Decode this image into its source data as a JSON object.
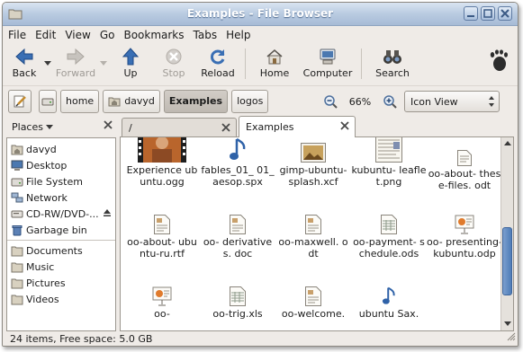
{
  "window": {
    "title": "Examples - File Browser"
  },
  "menubar": {
    "items": [
      "File",
      "Edit",
      "View",
      "Go",
      "Bookmarks",
      "Tabs",
      "Help"
    ]
  },
  "toolbar": {
    "back": "Back",
    "forward": "Forward",
    "up": "Up",
    "stop": "Stop",
    "reload": "Reload",
    "home": "Home",
    "computer": "Computer",
    "search": "Search"
  },
  "location": {
    "crumbs": [
      "home",
      "davyd",
      "Examples",
      "logos"
    ],
    "zoom_level": "66%",
    "view_mode": "Icon View"
  },
  "sidebar": {
    "header": "Places",
    "items": [
      {
        "label": "davyd",
        "icon": "home-folder-icon"
      },
      {
        "label": "Desktop",
        "icon": "desktop-icon"
      },
      {
        "label": "File System",
        "icon": "harddisk-icon"
      },
      {
        "label": "Network",
        "icon": "network-icon"
      },
      {
        "label": "CD-RW/DVD-...",
        "icon": "optical-drive-icon"
      },
      {
        "label": "Garbage bin",
        "icon": "trash-icon"
      }
    ],
    "bookmarks": [
      {
        "label": "Documents",
        "icon": "folder-icon"
      },
      {
        "label": "Music",
        "icon": "folder-icon"
      },
      {
        "label": "Pictures",
        "icon": "folder-icon"
      },
      {
        "label": "Videos",
        "icon": "folder-icon"
      }
    ]
  },
  "tabs": [
    {
      "label": "/",
      "active": false
    },
    {
      "label": "Examples",
      "active": true
    }
  ],
  "files": [
    {
      "name": "Experience ubuntu.ogg",
      "icon": "video-thumbnail-icon"
    },
    {
      "name": "fables_01_ 01_aesop.spx",
      "icon": "audio-note-icon"
    },
    {
      "name": "gimp-ubuntu- splash.xcf",
      "icon": "image-thumbnail-icon"
    },
    {
      "name": "kubuntu- leaflet.png",
      "icon": "document-thumbnail-icon"
    },
    {
      "name": "oo-about- these-files. odt",
      "icon": "text-document-icon"
    },
    {
      "name": "oo-about- ubuntu-ru.rtf",
      "icon": "text-document-icon"
    },
    {
      "name": "oo- derivatives. doc",
      "icon": "text-document-icon"
    },
    {
      "name": "oo-maxwell. odt",
      "icon": "text-document-icon"
    },
    {
      "name": "oo-payment- schedule.ods",
      "icon": "spreadsheet-icon"
    },
    {
      "name": "oo- presenting- kubuntu.odp",
      "icon": "presentation-icon"
    },
    {
      "name": "oo-",
      "icon": "presentation-icon"
    },
    {
      "name": "oo-trig.xls",
      "icon": "spreadsheet-icon"
    },
    {
      "name": "oo-welcome.",
      "icon": "text-document-icon"
    },
    {
      "name": "ubuntu Sax.",
      "icon": "audio-note-icon"
    }
  ],
  "status": {
    "text": "24 items, Free space: 5.0 GB"
  },
  "colors": {
    "titlebar": "#b9cbe1",
    "scroll_thumb": "#4f7cb8",
    "window_bg": "#efebe7"
  }
}
